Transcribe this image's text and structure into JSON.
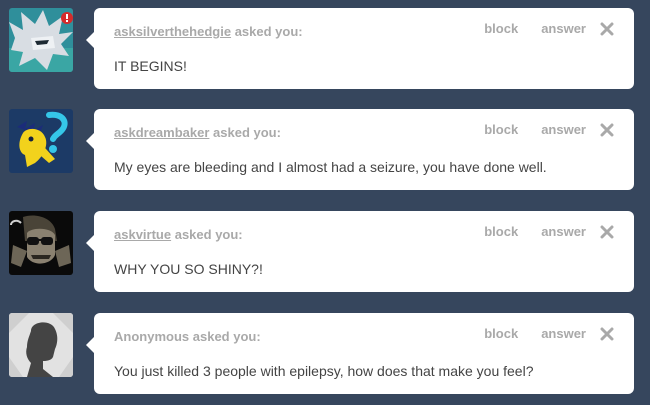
{
  "colors": {
    "background": "#36465d",
    "card": "#ffffff",
    "meta_text": "#a9a9a9",
    "question_text": "#444444"
  },
  "asks": [
    {
      "asker": "asksilverthehedgie",
      "asker_is_anonymous": false,
      "asked_label": "asked you:",
      "question": "IT BEGINS!",
      "block_label": "block",
      "answer_label": "answer",
      "close_icon": "close-icon"
    },
    {
      "asker": "askdreambaker",
      "asker_is_anonymous": false,
      "asked_label": "asked you:",
      "question": "My eyes are bleeding and I almost had a seizure, you have done well.",
      "block_label": "block",
      "answer_label": "answer",
      "close_icon": "close-icon"
    },
    {
      "asker": "askvirtue",
      "asker_is_anonymous": false,
      "asked_label": "asked you:",
      "question": "WHY YOU SO SHINY?!",
      "block_label": "block",
      "answer_label": "answer",
      "close_icon": "close-icon"
    },
    {
      "asker": "Anonymous",
      "asker_is_anonymous": true,
      "asked_label": "asked you:",
      "question": "You just killed 3 people with epilepsy, how does that make you feel?",
      "block_label": "block",
      "answer_label": "answer",
      "close_icon": "close-icon"
    }
  ]
}
